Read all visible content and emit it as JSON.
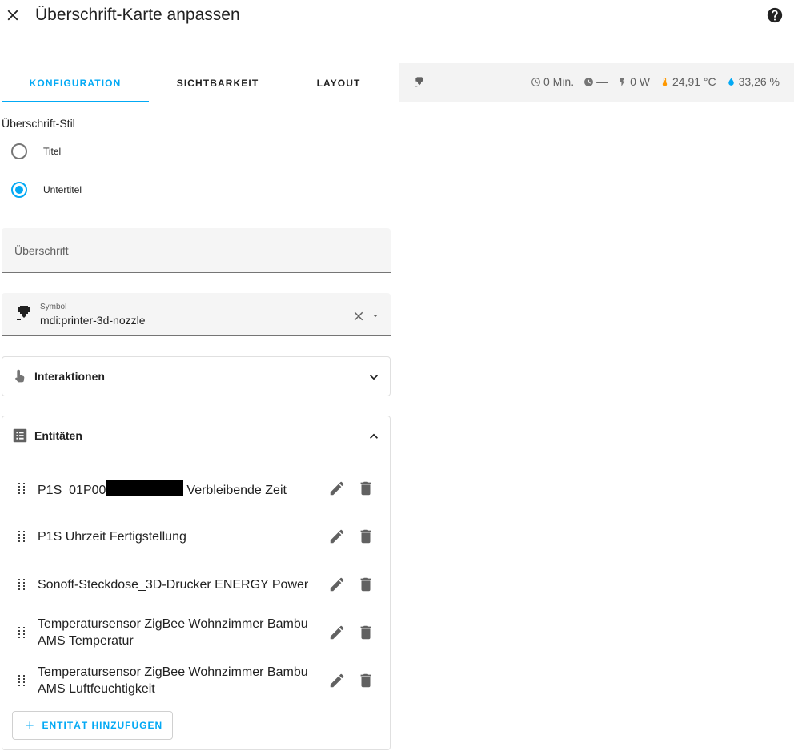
{
  "dialog": {
    "title": "Überschrift-Karte anpassen",
    "close_icon": "close-icon",
    "help_icon": "help-circle-icon"
  },
  "tabs": [
    {
      "label": "KONFIGURATION",
      "active": true
    },
    {
      "label": "SICHTBARKEIT",
      "active": false
    },
    {
      "label": "LAYOUT",
      "active": false
    }
  ],
  "style_section": {
    "label": "Überschrift-Stil",
    "options": [
      {
        "label": "Titel",
        "selected": false
      },
      {
        "label": "Untertitel",
        "selected": true
      }
    ]
  },
  "heading_field": {
    "placeholder": "Überschrift",
    "value": ""
  },
  "icon_field": {
    "label": "Symbol",
    "value": "mdi:printer-3d-nozzle",
    "icon": "printer-3d-nozzle-icon"
  },
  "interactions": {
    "title": "Interaktionen",
    "expanded": false
  },
  "entities": {
    "title": "Entitäten",
    "expanded": true,
    "items": [
      {
        "name_prefix": "P1S_01P00",
        "name": "Verbleibende Zeit",
        "redacted": true
      },
      {
        "name": "P1S Uhrzeit Fertigstellung"
      },
      {
        "name": "Sonoff-Steckdose_3D-Drucker ENERGY Power"
      },
      {
        "name": "Temperatursensor ZigBee Wohnzimmer Bambu AMS Temperatur"
      },
      {
        "name": "Temperatursensor ZigBee Wohnzimmer Bambu AMS Luftfeuchtigkeit"
      }
    ],
    "add_button": "ENTITÄT HINZUFÜGEN"
  },
  "preview": {
    "icon": "printer-3d-nozzle-icon",
    "badges": [
      {
        "icon": "timer-icon",
        "text": "0 Min.",
        "color": "#757575"
      },
      {
        "icon": "clock-icon",
        "text": "—",
        "color": "#757575"
      },
      {
        "icon": "flash-icon",
        "text": "0 W",
        "color": "#757575"
      },
      {
        "icon": "thermometer-icon",
        "text": "24,91 °C",
        "color": "#ff9800"
      },
      {
        "icon": "water-percent-icon",
        "text": "33,26 %",
        "color": "#03a9f4"
      }
    ]
  },
  "colors": {
    "accent": "#03a9f4",
    "text": "#212121",
    "secondary_text": "#616161",
    "icon": "#616161"
  }
}
